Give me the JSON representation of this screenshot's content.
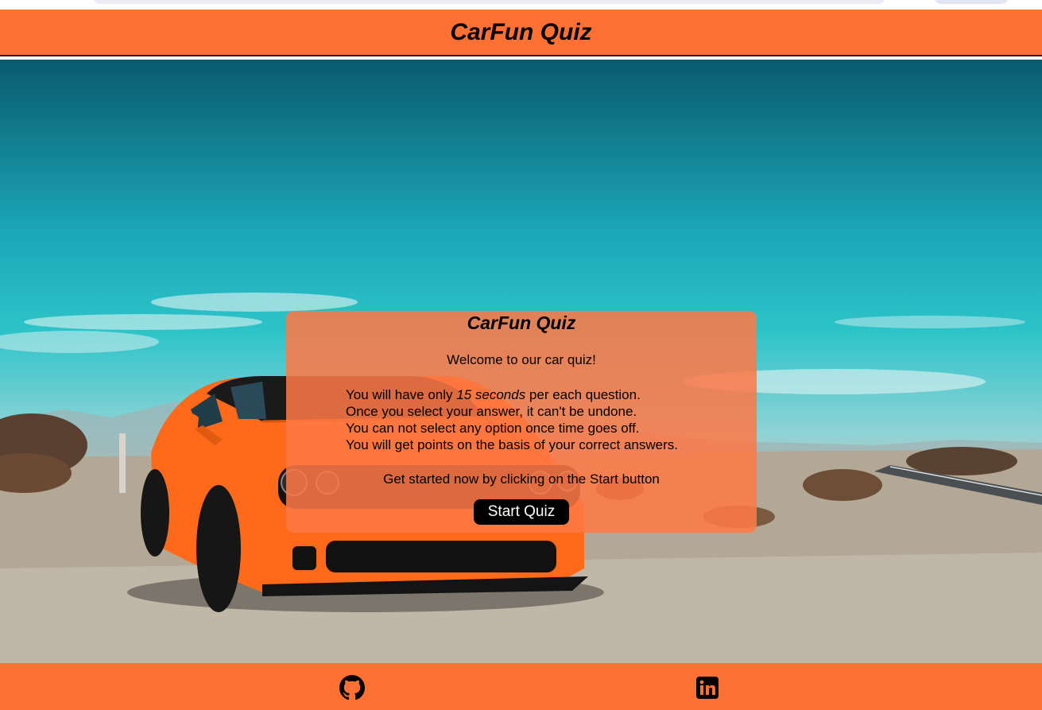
{
  "header": {
    "title": "CarFun Quiz"
  },
  "card": {
    "title": "CarFun Quiz",
    "welcome": "Welcome to our car quiz!",
    "rules": {
      "line1_before": "You will have only ",
      "line1_emphasis": "15 seconds",
      "line1_after": " per each question.",
      "line2": "Once you select your answer, it can't be undone.",
      "line3": "You can not select any option once time goes off.",
      "line4": "You will get points on the basis of your correct answers."
    },
    "cta": "Get started now by clicking on the Start button",
    "start_button": "Start Quiz"
  },
  "footer": {
    "links": [
      {
        "icon": "github-icon"
      },
      {
        "icon": "linkedin-icon"
      }
    ]
  },
  "colors": {
    "brand_orange": "#ff7033",
    "button_bg": "#000000",
    "button_text": "#ffffff"
  }
}
